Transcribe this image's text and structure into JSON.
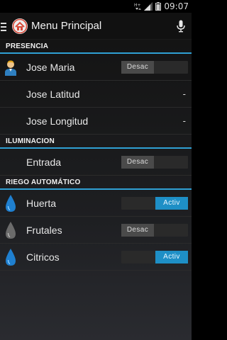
{
  "status_bar": {
    "time": "09:07",
    "icons": [
      "data-hplus-icon",
      "signal-icon",
      "battery-icon"
    ]
  },
  "action_bar": {
    "title": "Menu Principal",
    "icons": [
      "hamburger-icon",
      "home-logo-icon",
      "microphone-icon"
    ]
  },
  "sections": {
    "presencia": {
      "header": "PRESENCIA",
      "rows": [
        {
          "label": "Jose Maria",
          "toggle": "Desac",
          "state": "off",
          "icon": "person-icon"
        },
        {
          "label": "Jose Latitud",
          "value": "-"
        },
        {
          "label": "Jose Longitud",
          "value": "-"
        }
      ]
    },
    "iluminacion": {
      "header": "ILUMINACION",
      "rows": [
        {
          "label": "Entrada",
          "toggle": "Desac",
          "state": "off"
        }
      ]
    },
    "riego": {
      "header": "RIEGO AUTOMÁTICO",
      "rows": [
        {
          "label": "Huerta",
          "toggle": "Activ",
          "state": "on",
          "icon": "water-drop-blue-icon"
        },
        {
          "label": "Frutales",
          "toggle": "Desac",
          "state": "off",
          "icon": "water-drop-grey-icon"
        },
        {
          "label": "Citricos",
          "toggle": "Activ",
          "state": "on",
          "icon": "water-drop-blue-icon"
        }
      ]
    }
  },
  "colors": {
    "accent": "#2fa0d4",
    "toggle_on": "#1e8fc6",
    "toggle_off": "#4a4a4a"
  }
}
